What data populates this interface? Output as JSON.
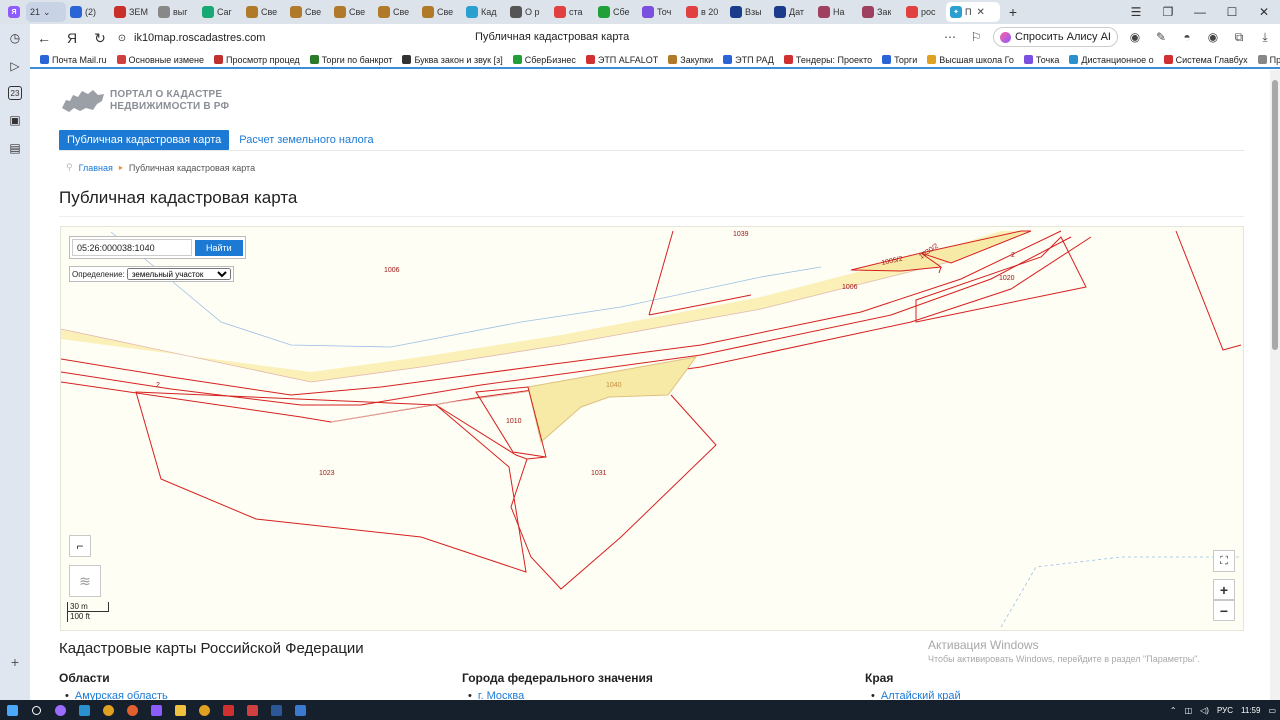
{
  "browser": {
    "tab_count": "21",
    "tabs": [
      {
        "label": "(2)",
        "color": "#2a64d6"
      },
      {
        "label": "ЗЕМ",
        "color": "#c9302c"
      },
      {
        "label": "выг",
        "color": "#888888"
      },
      {
        "label": "Car",
        "color": "#19a974"
      },
      {
        "label": "Све",
        "color": "#b07a2a"
      },
      {
        "label": "Све",
        "color": "#b07a2a"
      },
      {
        "label": "Све",
        "color": "#b07a2a"
      },
      {
        "label": "Све",
        "color": "#b07a2a"
      },
      {
        "label": "Све",
        "color": "#b07a2a"
      },
      {
        "label": "Кад",
        "color": "#2aa0d0"
      },
      {
        "label": "О р",
        "color": "#555555"
      },
      {
        "label": "ста",
        "color": "#e04040"
      },
      {
        "label": "Сбе",
        "color": "#21a038"
      },
      {
        "label": "Точ",
        "color": "#7b4fe0"
      },
      {
        "label": "в 20",
        "color": "#e04040"
      },
      {
        "label": "Взы",
        "color": "#1a3c8a"
      },
      {
        "label": "Дат",
        "color": "#1a3c8a"
      },
      {
        "label": "На",
        "color": "#a04060"
      },
      {
        "label": "Зак",
        "color": "#a04060"
      },
      {
        "label": "рос",
        "color": "#e04040"
      }
    ],
    "active_tab": {
      "label": "П",
      "color": "#2aa0d0"
    },
    "url": "ik10map.roscadastres.com",
    "page_title": "Публичная кадастровая карта",
    "alice_label": "Спросить Алису AI",
    "bookmarks": [
      {
        "label": "Почта Mail.ru",
        "color": "#2a64d6"
      },
      {
        "label": "Основные измене",
        "color": "#d04040"
      },
      {
        "label": "Просмотр процед",
        "color": "#c03030"
      },
      {
        "label": "Торги по банкрот",
        "color": "#2a7a2a"
      },
      {
        "label": "Буква закон и звук [з]",
        "color": "#333333"
      },
      {
        "label": "СберБизнес",
        "color": "#21a038"
      },
      {
        "label": "ЭТП ALFALOT",
        "color": "#d03030"
      },
      {
        "label": "Закупки",
        "color": "#b07a2a"
      },
      {
        "label": "ЭТП РАД",
        "color": "#2a64d6"
      },
      {
        "label": "Тендеры: Проекто",
        "color": "#d03030"
      },
      {
        "label": "Торги",
        "color": "#2a64d6"
      },
      {
        "label": "Высшая школа Го",
        "color": "#e0a020"
      },
      {
        "label": "Точка",
        "color": "#7b4fe0"
      },
      {
        "label": "Дистанционное о",
        "color": "#2a90d0"
      },
      {
        "label": "Система Главбух",
        "color": "#d03030"
      },
      {
        "label": "Проф",
        "color": "#888888"
      }
    ]
  },
  "site": {
    "logo_line1": "ПОРТАЛ О КАДАСТРЕ",
    "logo_line2": "НЕДВИЖИМОСТИ В РФ",
    "menu_active": "Публичная кадастровая карта",
    "menu_link": "Расчет земельного налога",
    "breadcrumb_home": "Главная",
    "breadcrumb_current": "Публичная кадастровая карта",
    "heading": "Публичная кадастровая карта"
  },
  "map": {
    "search_value": "05:26:000038:1040",
    "find_label": "Найти",
    "definition_label": "Определение:",
    "definition_value": "земельный участок",
    "scale_m": "30 m",
    "scale_ft": "100 ft",
    "zoom_in": "+",
    "zoom_out": "−",
    "parcel_labels": [
      {
        "text": "1039",
        "cls": "1039"
      },
      {
        "text": "1006",
        "cls": "1006a"
      },
      {
        "text": "1006",
        "cls": "1006b"
      },
      {
        "text": "1005/2",
        "cls": "1005"
      },
      {
        "text": "1030/2",
        "cls": "1030"
      },
      {
        "text": "2",
        "cls": "2a"
      },
      {
        "text": "1020",
        "cls": "1020"
      },
      {
        "text": "2",
        "cls": "2b"
      },
      {
        "text": "1040",
        "cls": "1040"
      },
      {
        "text": "1010",
        "cls": "1010"
      },
      {
        "text": "1023",
        "cls": "1023"
      },
      {
        "text": "1031",
        "cls": "1031"
      }
    ],
    "colors": {
      "boundary": "#d62020",
      "selected_fill": "#f7e9a6",
      "road_fill": "#faf0b8",
      "background": "#fefef4"
    }
  },
  "below": {
    "heading": "Кадастровые карты Российской Федерации",
    "col1_head": "Области",
    "col1_item": "Амурская область",
    "col2_head": "Города федерального значения",
    "col2_item": "г. Москва",
    "col3_head": "Края",
    "col3_item": "Алтайский край"
  },
  "watermark": {
    "line1": "Активация Windows",
    "line2": "Чтобы активировать Windows, перейдите в раздел \"Параметры\"."
  },
  "taskbar": {
    "lang": "РУС",
    "time": "11:59"
  }
}
